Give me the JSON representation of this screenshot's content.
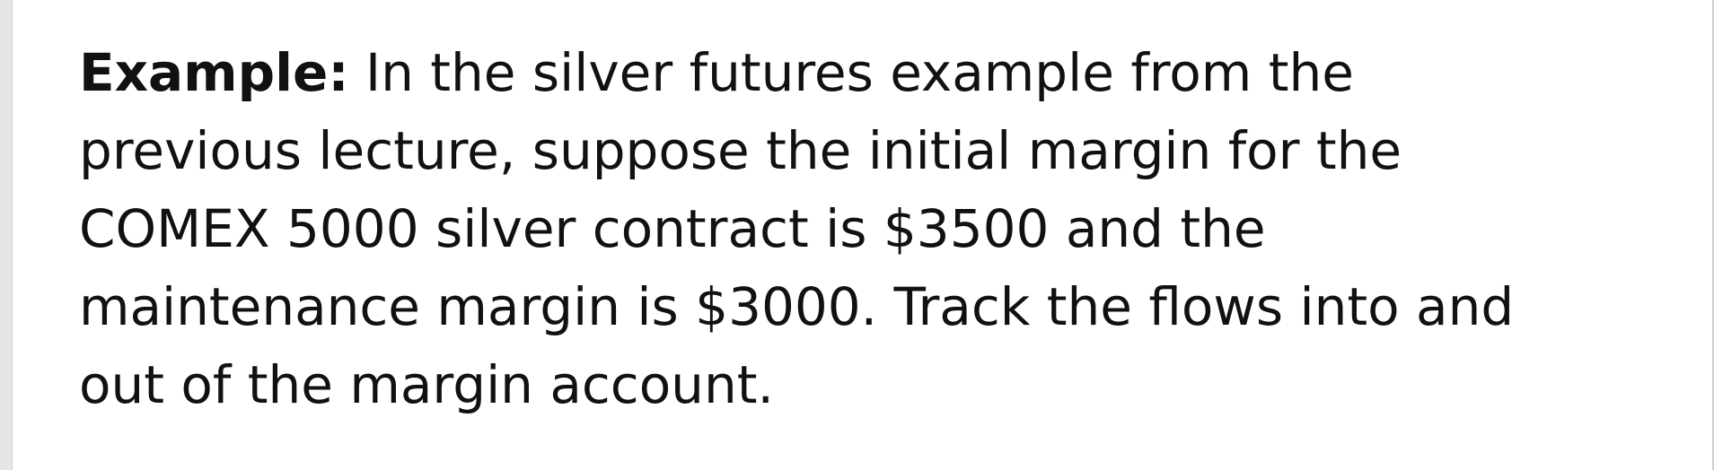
{
  "example": {
    "label": "Example:",
    "lines": [
      "In the silver futures example from the",
      "previous lecture, suppose the initial margin for the",
      "COMEX 5000 silver contract is $3500 and the",
      "maintenance margin is $3000.  Track the flows into and",
      "out of the margin account."
    ]
  }
}
